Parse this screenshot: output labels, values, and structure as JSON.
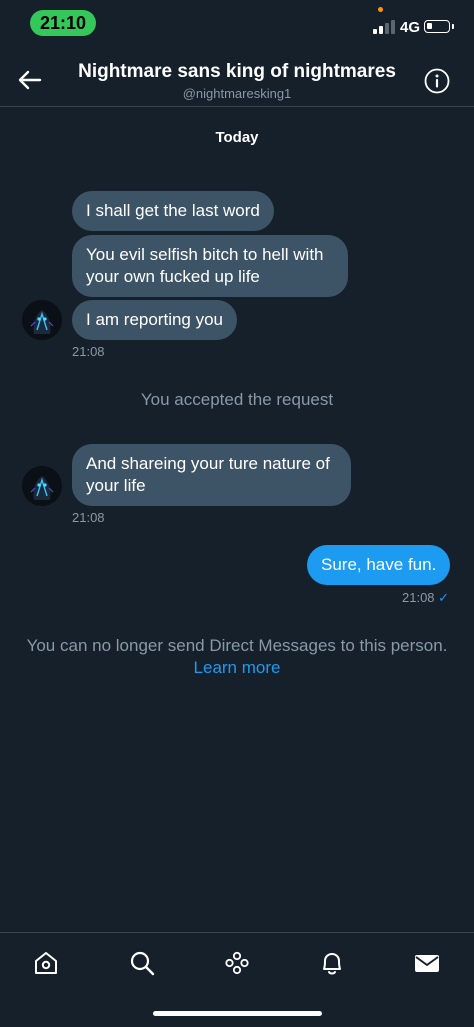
{
  "status_bar": {
    "time": "21:10",
    "network": "4G",
    "signal_bars_filled": 2,
    "signal_bars_total": 4,
    "battery_level": 0.2
  },
  "header": {
    "back_icon": "arrow-left-icon",
    "title": "Nightmare sans king of nightmares",
    "handle": "@nightmaresking1",
    "info_icon": "info-icon"
  },
  "conversation": {
    "date_label": "Today",
    "group1": {
      "messages": [
        "I shall get the last word",
        "You evil selfish bitch to hell with",
        "your own fucked up life",
        "I am reporting you"
      ],
      "timestamp": "21:08"
    },
    "system_message": "You accepted the request",
    "group2": {
      "line1": "And shareing your ture nature of",
      "line2": "your life",
      "timestamp": "21:08"
    },
    "outgoing": {
      "text": "Sure, have fun.",
      "timestamp": "21:08",
      "status_icon": "checkmark-icon"
    },
    "notice": {
      "text": "You can no longer send Direct Messages to this person.",
      "link": "Learn more"
    }
  },
  "tab_bar": {
    "items": [
      "home-icon",
      "search-icon",
      "spaces-icon",
      "notifications-icon",
      "messages-icon"
    ],
    "active": "messages-icon"
  },
  "colors": {
    "background": "#15202b",
    "incoming_bubble": "#3d5466",
    "outgoing_bubble": "#1d9bf0",
    "accent": "#1d9bf0",
    "muted_text": "#8b98a5",
    "status_pill": "#34c759"
  }
}
